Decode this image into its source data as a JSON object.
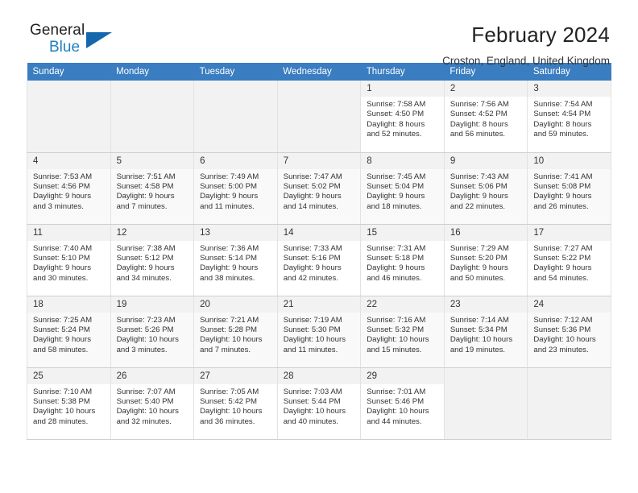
{
  "brand": {
    "name_part1": "General",
    "name_part2": "Blue",
    "triangle_color": "#1567ad",
    "blue_color": "#1f7fc4"
  },
  "header": {
    "month_year": "February 2024",
    "location": "Croston, England, United Kingdom"
  },
  "calendar": {
    "header_bg": "#3a7dc0",
    "weekday_headers": [
      "Sunday",
      "Monday",
      "Tuesday",
      "Wednesday",
      "Thursday",
      "Friday",
      "Saturday"
    ],
    "weeks": [
      [
        null,
        null,
        null,
        null,
        {
          "day": "1",
          "sunrise": "Sunrise: 7:58 AM",
          "sunset": "Sunset: 4:50 PM",
          "daylight_line1": "Daylight: 8 hours",
          "daylight_line2": "and 52 minutes."
        },
        {
          "day": "2",
          "sunrise": "Sunrise: 7:56 AM",
          "sunset": "Sunset: 4:52 PM",
          "daylight_line1": "Daylight: 8 hours",
          "daylight_line2": "and 56 minutes."
        },
        {
          "day": "3",
          "sunrise": "Sunrise: 7:54 AM",
          "sunset": "Sunset: 4:54 PM",
          "daylight_line1": "Daylight: 8 hours",
          "daylight_line2": "and 59 minutes."
        }
      ],
      [
        {
          "day": "4",
          "sunrise": "Sunrise: 7:53 AM",
          "sunset": "Sunset: 4:56 PM",
          "daylight_line1": "Daylight: 9 hours",
          "daylight_line2": "and 3 minutes."
        },
        {
          "day": "5",
          "sunrise": "Sunrise: 7:51 AM",
          "sunset": "Sunset: 4:58 PM",
          "daylight_line1": "Daylight: 9 hours",
          "daylight_line2": "and 7 minutes."
        },
        {
          "day": "6",
          "sunrise": "Sunrise: 7:49 AM",
          "sunset": "Sunset: 5:00 PM",
          "daylight_line1": "Daylight: 9 hours",
          "daylight_line2": "and 11 minutes."
        },
        {
          "day": "7",
          "sunrise": "Sunrise: 7:47 AM",
          "sunset": "Sunset: 5:02 PM",
          "daylight_line1": "Daylight: 9 hours",
          "daylight_line2": "and 14 minutes."
        },
        {
          "day": "8",
          "sunrise": "Sunrise: 7:45 AM",
          "sunset": "Sunset: 5:04 PM",
          "daylight_line1": "Daylight: 9 hours",
          "daylight_line2": "and 18 minutes."
        },
        {
          "day": "9",
          "sunrise": "Sunrise: 7:43 AM",
          "sunset": "Sunset: 5:06 PM",
          "daylight_line1": "Daylight: 9 hours",
          "daylight_line2": "and 22 minutes."
        },
        {
          "day": "10",
          "sunrise": "Sunrise: 7:41 AM",
          "sunset": "Sunset: 5:08 PM",
          "daylight_line1": "Daylight: 9 hours",
          "daylight_line2": "and 26 minutes."
        }
      ],
      [
        {
          "day": "11",
          "sunrise": "Sunrise: 7:40 AM",
          "sunset": "Sunset: 5:10 PM",
          "daylight_line1": "Daylight: 9 hours",
          "daylight_line2": "and 30 minutes."
        },
        {
          "day": "12",
          "sunrise": "Sunrise: 7:38 AM",
          "sunset": "Sunset: 5:12 PM",
          "daylight_line1": "Daylight: 9 hours",
          "daylight_line2": "and 34 minutes."
        },
        {
          "day": "13",
          "sunrise": "Sunrise: 7:36 AM",
          "sunset": "Sunset: 5:14 PM",
          "daylight_line1": "Daylight: 9 hours",
          "daylight_line2": "and 38 minutes."
        },
        {
          "day": "14",
          "sunrise": "Sunrise: 7:33 AM",
          "sunset": "Sunset: 5:16 PM",
          "daylight_line1": "Daylight: 9 hours",
          "daylight_line2": "and 42 minutes."
        },
        {
          "day": "15",
          "sunrise": "Sunrise: 7:31 AM",
          "sunset": "Sunset: 5:18 PM",
          "daylight_line1": "Daylight: 9 hours",
          "daylight_line2": "and 46 minutes."
        },
        {
          "day": "16",
          "sunrise": "Sunrise: 7:29 AM",
          "sunset": "Sunset: 5:20 PM",
          "daylight_line1": "Daylight: 9 hours",
          "daylight_line2": "and 50 minutes."
        },
        {
          "day": "17",
          "sunrise": "Sunrise: 7:27 AM",
          "sunset": "Sunset: 5:22 PM",
          "daylight_line1": "Daylight: 9 hours",
          "daylight_line2": "and 54 minutes."
        }
      ],
      [
        {
          "day": "18",
          "sunrise": "Sunrise: 7:25 AM",
          "sunset": "Sunset: 5:24 PM",
          "daylight_line1": "Daylight: 9 hours",
          "daylight_line2": "and 58 minutes."
        },
        {
          "day": "19",
          "sunrise": "Sunrise: 7:23 AM",
          "sunset": "Sunset: 5:26 PM",
          "daylight_line1": "Daylight: 10 hours",
          "daylight_line2": "and 3 minutes."
        },
        {
          "day": "20",
          "sunrise": "Sunrise: 7:21 AM",
          "sunset": "Sunset: 5:28 PM",
          "daylight_line1": "Daylight: 10 hours",
          "daylight_line2": "and 7 minutes."
        },
        {
          "day": "21",
          "sunrise": "Sunrise: 7:19 AM",
          "sunset": "Sunset: 5:30 PM",
          "daylight_line1": "Daylight: 10 hours",
          "daylight_line2": "and 11 minutes."
        },
        {
          "day": "22",
          "sunrise": "Sunrise: 7:16 AM",
          "sunset": "Sunset: 5:32 PM",
          "daylight_line1": "Daylight: 10 hours",
          "daylight_line2": "and 15 minutes."
        },
        {
          "day": "23",
          "sunrise": "Sunrise: 7:14 AM",
          "sunset": "Sunset: 5:34 PM",
          "daylight_line1": "Daylight: 10 hours",
          "daylight_line2": "and 19 minutes."
        },
        {
          "day": "24",
          "sunrise": "Sunrise: 7:12 AM",
          "sunset": "Sunset: 5:36 PM",
          "daylight_line1": "Daylight: 10 hours",
          "daylight_line2": "and 23 minutes."
        }
      ],
      [
        {
          "day": "25",
          "sunrise": "Sunrise: 7:10 AM",
          "sunset": "Sunset: 5:38 PM",
          "daylight_line1": "Daylight: 10 hours",
          "daylight_line2": "and 28 minutes."
        },
        {
          "day": "26",
          "sunrise": "Sunrise: 7:07 AM",
          "sunset": "Sunset: 5:40 PM",
          "daylight_line1": "Daylight: 10 hours",
          "daylight_line2": "and 32 minutes."
        },
        {
          "day": "27",
          "sunrise": "Sunrise: 7:05 AM",
          "sunset": "Sunset: 5:42 PM",
          "daylight_line1": "Daylight: 10 hours",
          "daylight_line2": "and 36 minutes."
        },
        {
          "day": "28",
          "sunrise": "Sunrise: 7:03 AM",
          "sunset": "Sunset: 5:44 PM",
          "daylight_line1": "Daylight: 10 hours",
          "daylight_line2": "and 40 minutes."
        },
        {
          "day": "29",
          "sunrise": "Sunrise: 7:01 AM",
          "sunset": "Sunset: 5:46 PM",
          "daylight_line1": "Daylight: 10 hours",
          "daylight_line2": "and 44 minutes."
        },
        null,
        null
      ]
    ]
  }
}
